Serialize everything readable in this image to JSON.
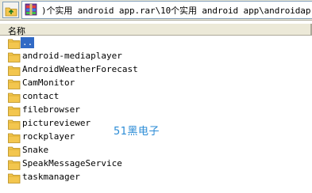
{
  "address_bar": {
    "path": ")个实用 android app.rar\\10个实用 android app\\androidap",
    "archive_icon": "winrar-archive-icon",
    "up_icon": "folder-up-icon"
  },
  "column_header": {
    "name": "名称"
  },
  "files": [
    {
      "label": "..",
      "icon": "folder-icon",
      "selected": true
    },
    {
      "label": "android-mediaplayer",
      "icon": "folder-icon"
    },
    {
      "label": "AndroidWeatherForecast",
      "icon": "folder-icon"
    },
    {
      "label": "CamMonitor",
      "icon": "folder-icon"
    },
    {
      "label": "contact",
      "icon": "folder-icon"
    },
    {
      "label": "filebrowser",
      "icon": "folder-icon"
    },
    {
      "label": "pictureviewer",
      "icon": "folder-icon"
    },
    {
      "label": "rockplayer",
      "icon": "folder-icon"
    },
    {
      "label": "Snake",
      "icon": "folder-icon"
    },
    {
      "label": "SpeakMessageService",
      "icon": "folder-icon"
    },
    {
      "label": "taskmanager",
      "icon": "folder-icon"
    }
  ],
  "watermark": "51黑电子",
  "colors": {
    "selection": "#316ac5",
    "watermark": "#2a8bd6",
    "folder": "#f3c64e"
  }
}
